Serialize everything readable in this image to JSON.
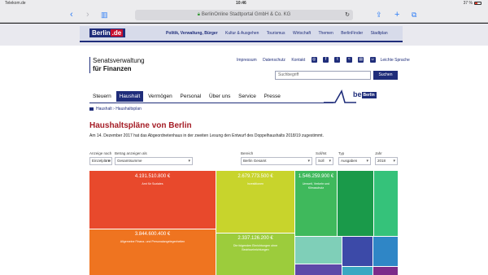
{
  "status": {
    "carrier": "Telekom.de",
    "time": "10:46",
    "battery": "37 %"
  },
  "browser": {
    "back_icon": "chevron-left-icon",
    "forward_icon": "chevron-right-icon",
    "bookmarks_icon": "book-icon",
    "url_text": "BerlinOnline Stadtportal GmbH & Co. KG",
    "reload_icon": "reload-icon",
    "share_icon": "share-icon",
    "newtab_icon": "plus-icon",
    "tabs_icon": "tabs-icon"
  },
  "portal": {
    "logo_text": "Berlin",
    "logo_suffix": ".de",
    "nav": [
      "Politik, Verwaltung, Bürger",
      "Kultur & Ausgehen",
      "Tourismus",
      "Wirtschaft",
      "Themen",
      "BerlinFinder",
      "Stadtplan"
    ]
  },
  "org": {
    "line1": "Senatsverwaltung",
    "line2": "für Finanzen"
  },
  "service_links": [
    "Impressum",
    "Datenschutz",
    "Kontakt"
  ],
  "social_icons": [
    "instagram-icon",
    "facebook-icon",
    "twitter-icon",
    "rss-icon",
    "print-icon",
    "easy-language-icon"
  ],
  "easy_language": "Leichte Sprache",
  "search": {
    "placeholder": "Suchbegriff",
    "button": "Suchen"
  },
  "main_nav": [
    {
      "label": "Steuern",
      "active": false
    },
    {
      "label": "Haushalt",
      "active": true
    },
    {
      "label": "Vermögen",
      "active": false
    },
    {
      "label": "Personal",
      "active": false
    },
    {
      "label": "Über uns",
      "active": false
    },
    {
      "label": "Service",
      "active": false
    },
    {
      "label": "Presse",
      "active": false
    }
  ],
  "be_logo": {
    "be": "be",
    "box": "Berlin"
  },
  "breadcrumb": [
    "Haushalt",
    "Haushaltsplan"
  ],
  "page_title": "Haushaltspläne von Berlin",
  "intro": "Am 14. Dezember 2017 hat das Abgeordnetenhaus in der zweiten Lesung den Entwurf des Doppelhaushalts 2018/19 zugestimmt.",
  "filters": [
    {
      "label": "Anzeige nach",
      "value": "Einzelpläne"
    },
    {
      "label": "Betrag anzeigen als",
      "value": "Gesamtsumme"
    },
    {
      "label": "Bereich",
      "value": "Berlin Gesamt"
    },
    {
      "label": "Soll/Ist",
      "value": "Soll"
    },
    {
      "label": "Typ",
      "value": "Ausgaben"
    },
    {
      "label": "Jahr",
      "value": "2018"
    }
  ],
  "treemap": [
    {
      "amount": "4.191.510.800 €",
      "name": "Amt für Soziales",
      "color": "#e8492c"
    },
    {
      "amount": "3.844.600.400 €",
      "name": "Allgemeine Finanz- und Personalangelegenheiten",
      "color": "#ef7420"
    },
    {
      "amount": "2.679.773.500 €",
      "name": "Investitionen",
      "color": "#c8d42c"
    },
    {
      "amount": "2.337.126.200 €",
      "name": "Die folgenden Einrichtungen ohne Bezirkseinrichtungen",
      "color": "#9ccc3c"
    },
    {
      "amount": "1.546.259.900 €",
      "name": "Umwelt, Verkehr und Klimaschutz",
      "color": "#3fb95c"
    },
    {
      "amount": "",
      "name": "",
      "color": "#1a9a4a"
    },
    {
      "amount": "",
      "name": "",
      "color": "#35c27a"
    },
    {
      "amount": "",
      "name": "",
      "color": "#7fcfb8"
    },
    {
      "amount": "",
      "name": "",
      "color": "#3c4aa8"
    },
    {
      "amount": "",
      "name": "",
      "color": "#2f86c6"
    },
    {
      "amount": "",
      "name": "",
      "color": "#5e49a8"
    },
    {
      "amount": "",
      "name": "",
      "color": "#3aa8c2"
    },
    {
      "amount": "",
      "name": "",
      "color": "#7c2b8a"
    }
  ]
}
